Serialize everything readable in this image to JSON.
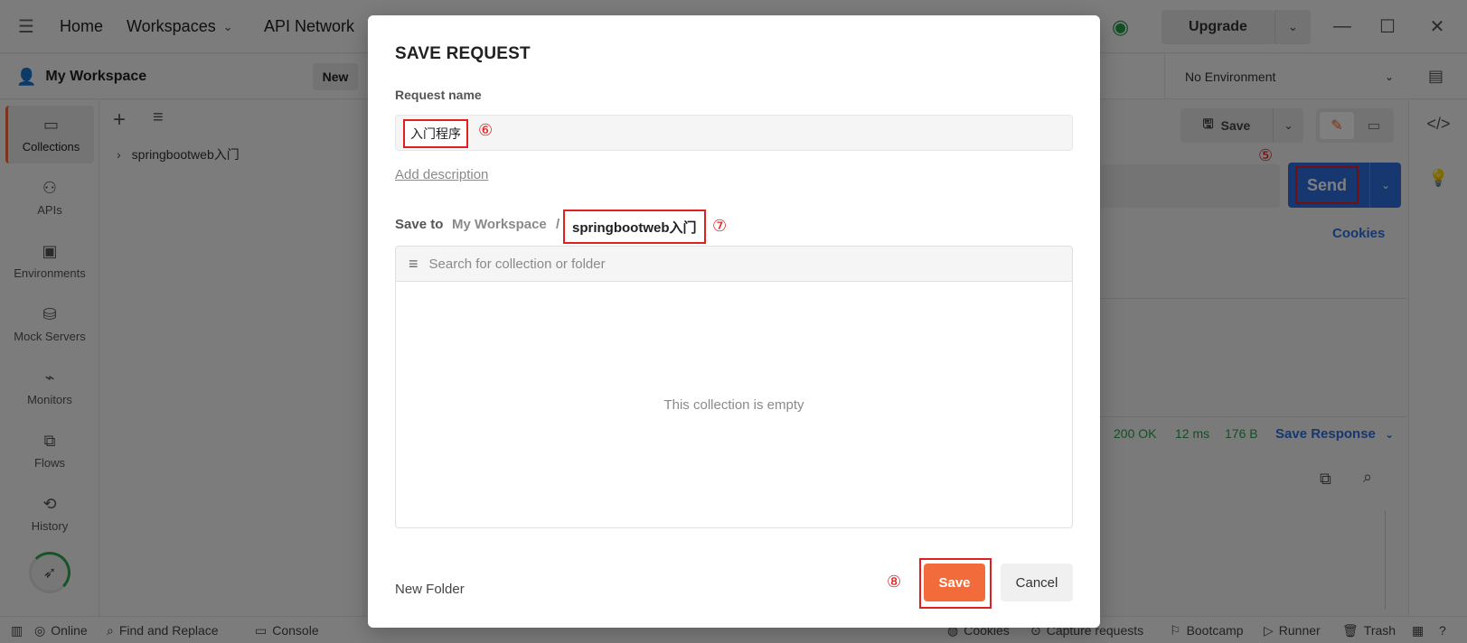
{
  "titlebar": {
    "menu_icon": "hamburger-icon",
    "nav": [
      "Home",
      "Workspaces",
      "API Network"
    ],
    "upgrade": "Upgrade"
  },
  "workspace": {
    "name": "My Workspace",
    "new_label": "New",
    "environment": "No Environment"
  },
  "rail": {
    "items": [
      "Collections",
      "APIs",
      "Environments",
      "Mock Servers",
      "Monitors",
      "Flows",
      "History"
    ]
  },
  "collections": {
    "items": [
      "springbootweb入门"
    ]
  },
  "background": {
    "save_label": "Save",
    "send_label": "Send",
    "send_marker": "⑤",
    "cookies": "Cookies",
    "status_code": "200 OK",
    "time": "12 ms",
    "size": "176 B",
    "save_response": "Save Response"
  },
  "statusbar": {
    "left": [
      "Online",
      "Find and Replace",
      "Console"
    ],
    "right": [
      "Cookies",
      "Capture requests",
      "Bootcamp",
      "Runner",
      "Trash"
    ]
  },
  "modal": {
    "title": "SAVE REQUEST",
    "name_label": "Request name",
    "name_value": "入门程序",
    "name_marker": "⑥",
    "add_description": "Add description",
    "save_to_label": "Save to",
    "breadcrumb_workspace": "My Workspace",
    "breadcrumb_separator": "/",
    "breadcrumb_collection": "springbootweb入门",
    "collection_marker": "⑦",
    "search_placeholder": "Search for collection or folder",
    "empty_message": "This collection is empty",
    "new_folder": "New Folder",
    "save_marker": "⑧",
    "save_button": "Save",
    "cancel_button": "Cancel"
  },
  "colors": {
    "accent_orange": "#f26b3a",
    "send_blue": "#2f6fe0",
    "annotation_red": "#e02020",
    "success_green": "#2a9d4a"
  }
}
